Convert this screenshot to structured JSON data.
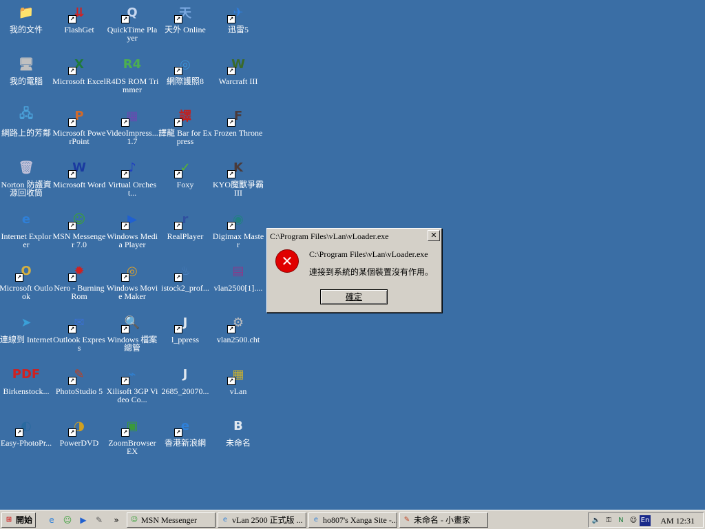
{
  "desktop_icons": [
    {
      "label": "我的文件",
      "glyph": "📁",
      "color": "#f2d15c",
      "shortcut": false
    },
    {
      "label": "FlashGet",
      "glyph": "⇊",
      "color": "#d42020",
      "shortcut": true
    },
    {
      "label": "QuickTime Player",
      "glyph": "Q",
      "color": "#c8d8f0",
      "shortcut": true
    },
    {
      "label": "天外 Online",
      "glyph": "天",
      "color": "#7aa8e0",
      "shortcut": true
    },
    {
      "label": "迅雷5",
      "glyph": "✈",
      "color": "#2f7fe0",
      "shortcut": true
    },
    {
      "label": "我的電腦",
      "glyph": "🖥",
      "color": "#c0c0c0",
      "shortcut": false
    },
    {
      "label": "Microsoft Excel",
      "glyph": "X",
      "color": "#1f7a3a",
      "shortcut": true
    },
    {
      "label": "R4DS ROM Trimmer",
      "glyph": "R4",
      "color": "#4caf50",
      "shortcut": false
    },
    {
      "label": "網際護照8",
      "glyph": "◎",
      "color": "#3b8fd4",
      "shortcut": true
    },
    {
      "label": "Warcraft III",
      "glyph": "W",
      "color": "#3a6a2a",
      "shortcut": true
    },
    {
      "label": "網路上的芳鄰",
      "glyph": "🖧",
      "color": "#4aa0d8",
      "shortcut": false
    },
    {
      "label": "Microsoft PowerPoint",
      "glyph": "P",
      "color": "#d26a2a",
      "shortcut": true
    },
    {
      "label": "VideoImpress... 1.7",
      "glyph": "▦",
      "color": "#6a4ab0",
      "shortcut": true
    },
    {
      "label": "譯龍 Bar for Express",
      "glyph": "譯",
      "color": "#c02020",
      "shortcut": true
    },
    {
      "label": "Frozen Throne",
      "glyph": "F",
      "color": "#4a3a3a",
      "shortcut": true
    },
    {
      "label": "Norton 防護資 源回收筒",
      "glyph": "🗑",
      "color": "#c0c0d8",
      "shortcut": false
    },
    {
      "label": "Microsoft Word",
      "glyph": "W",
      "color": "#1a3aa0",
      "shortcut": true
    },
    {
      "label": "Virtual Orchest...",
      "glyph": "♪",
      "color": "#2040c0",
      "shortcut": true
    },
    {
      "label": "Foxy",
      "glyph": "✓",
      "color": "#5ab82a",
      "shortcut": true
    },
    {
      "label": "KYO魔獸爭霸 III",
      "glyph": "K",
      "color": "#4a3a3a",
      "shortcut": true
    },
    {
      "label": "Internet Explorer",
      "glyph": "e",
      "color": "#2f80d8",
      "shortcut": false
    },
    {
      "label": "MSN Messenger 7.0",
      "glyph": "☺",
      "color": "#3aa03a",
      "shortcut": true
    },
    {
      "label": "Windows Media Player",
      "glyph": "▶",
      "color": "#2060d0",
      "shortcut": true
    },
    {
      "label": "RealPlayer",
      "glyph": "r",
      "color": "#3050a0",
      "shortcut": true
    },
    {
      "label": "Digimax Master",
      "glyph": "◉",
      "color": "#208080",
      "shortcut": true
    },
    {
      "label": "Microsoft Outlook",
      "glyph": "O",
      "color": "#d4b040",
      "shortcut": true
    },
    {
      "label": "Nero - Burning Rom",
      "glyph": "✹",
      "color": "#d02020",
      "shortcut": true
    },
    {
      "label": "Windows Movie Maker",
      "glyph": "◎",
      "color": "#d8a030",
      "shortcut": true
    },
    {
      "label": "istock2_prof...",
      "glyph": "♨",
      "color": "#4a80c0",
      "shortcut": true
    },
    {
      "label": "vlan2500[1]....",
      "glyph": "▤",
      "color": "#8a3a8a",
      "shortcut": false
    },
    {
      "label": "連線到 Internet",
      "glyph": "➤",
      "color": "#3aa0d8",
      "shortcut": false
    },
    {
      "label": "Outlook Express",
      "glyph": "✉",
      "color": "#3a70d0",
      "shortcut": true
    },
    {
      "label": "Windows 檔案 總管",
      "glyph": "🔍",
      "color": "#e0c040",
      "shortcut": true
    },
    {
      "label": "l_ppress",
      "glyph": "J",
      "color": "#e0e8f0",
      "shortcut": true
    },
    {
      "label": "vlan2500.cht",
      "glyph": "⚙",
      "color": "#c0c0c0",
      "shortcut": true
    },
    {
      "label": "Birkenstock...",
      "glyph": "PDF",
      "color": "#d02020",
      "shortcut": false
    },
    {
      "label": "PhotoStudio 5",
      "glyph": "✎",
      "color": "#c04020",
      "shortcut": true
    },
    {
      "label": "Xilisoft 3GP Video Co...",
      "glyph": "⌁",
      "color": "#3080d0",
      "shortcut": true
    },
    {
      "label": "2685_20070...",
      "glyph": "J",
      "color": "#e0e8f0",
      "shortcut": false
    },
    {
      "label": "vLan",
      "glyph": "▦",
      "color": "#c8b030",
      "shortcut": true
    },
    {
      "label": "Easy-PhotoPr...",
      "glyph": "◐",
      "color": "#2a6aa0",
      "shortcut": true
    },
    {
      "label": "PowerDVD",
      "glyph": "◑",
      "color": "#d0a020",
      "shortcut": true
    },
    {
      "label": "ZoomBrowser EX",
      "glyph": "▣",
      "color": "#3a9a3a",
      "shortcut": true
    },
    {
      "label": "香港新浪網",
      "glyph": "e",
      "color": "#2f80d8",
      "shortcut": true
    },
    {
      "label": "未命名",
      "glyph": "B",
      "color": "#e0e8f0",
      "shortcut": false
    }
  ],
  "dialog": {
    "title": "C:\\Program Files\\vLan\\vLoader.exe",
    "message_path": "C:\\Program Files\\vLan\\vLoader.exe",
    "message": "連接到系統的某個裝置沒有作用。",
    "ok_label": "確定",
    "close_glyph": "✕"
  },
  "taskbar": {
    "start_label": "開始",
    "quick_launch": [
      {
        "name": "ie-quicklaunch-icon",
        "glyph": "e",
        "color": "#2f80d8"
      },
      {
        "name": "msn-quicklaunch-icon",
        "glyph": "☺",
        "color": "#3aa03a"
      },
      {
        "name": "media-player-quicklaunch-icon",
        "glyph": "▶",
        "color": "#2060d0"
      },
      {
        "name": "notepad-quicklaunch-icon",
        "glyph": "✎",
        "color": "#606060"
      }
    ],
    "more_glyph": "»",
    "tasks": [
      {
        "label": "MSN Messenger",
        "glyph": "☺",
        "color": "#3aa03a"
      },
      {
        "label": "vLan 2500 正式版 ...",
        "glyph": "e",
        "color": "#2f80d8"
      },
      {
        "label": "ho807's Xanga Site -...",
        "glyph": "e",
        "color": "#2f80d8"
      },
      {
        "label": "未命名 - 小畫家",
        "glyph": "✎",
        "color": "#c04020"
      }
    ],
    "tray_lang": "En",
    "clock": "AM 12:31"
  }
}
